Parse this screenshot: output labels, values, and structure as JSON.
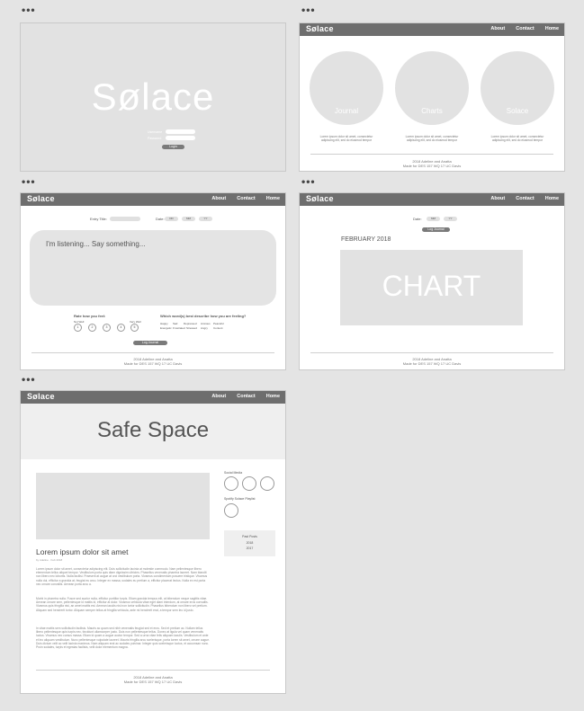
{
  "colors": {
    "background": "#e4e4e4",
    "nav": "#6e6e6e",
    "placeholder": "#e2e2e2",
    "button": "#7a7a7a"
  },
  "brand": "Sølace",
  "nav_links": [
    "About",
    "Contact",
    "Home"
  ],
  "login": {
    "logo": "Sølace",
    "username_label": "Username",
    "password_label": "Password",
    "button": "Login"
  },
  "home": {
    "nav_links": [
      "About",
      "Contact",
      "Home"
    ],
    "cards": [
      {
        "title": "Journal",
        "desc": "Lorem ipsum dolor sit amet, consectetur adipiscing elit, sed do eiusmod tempor"
      },
      {
        "title": "Charts",
        "desc": "Lorem ipsum dolor sit amet, consectetur adipiscing elit, sed do eiusmod tempor"
      },
      {
        "title": "Solace",
        "desc": "Lorem ipsum dolor sit amet, consectetur adipiscing elit, sed do eiusmod tempor"
      }
    ]
  },
  "footer": {
    "line1": "2018 Adeline and Anatta",
    "line2": "Made for DES 157 WQ 17 UC Davis"
  },
  "journal": {
    "entry_title_label": "Entry Title:",
    "date_label": "Date:",
    "date_fields": [
      "DD",
      "MM",
      "YY"
    ],
    "prompt": "I'm listening... Say something...",
    "feel_label": "Rate how you feel:",
    "scale_low": "Not Well",
    "scale_high": "Very Well",
    "ratings": [
      "1",
      "2",
      "3",
      "4",
      "5"
    ],
    "words_label": "Which word(s) best describe how you are feeling?",
    "words": [
      "Happy",
      "Sad",
      "Depressed",
      "Anxious",
      "Peaceful",
      "Energetic",
      "Frustrated",
      "Stressed",
      "Angry",
      "Content"
    ],
    "button": "Log Journal"
  },
  "chart_page": {
    "date_label": "Date:",
    "date_fields": [
      "MM",
      "YY"
    ],
    "button": "Log Journal",
    "month": "FEBRUARY 2018",
    "chart_placeholder": "CHART"
  },
  "blog": {
    "hero": "Safe Space",
    "post_title": "Lorem ipsum dolor sit amet",
    "post_meta": "by Adeline · Feb 2018",
    "paragraphs": [
      "Lorem ipsum dolor sit amet, consectetur adipiscing elit. Duis sollicitudin lacinia at molestie commodo. Nam pellentesque libero elementum tellus aliquet tempor. Vestibulum porta quis diam dignissim ultricies. Phasellus venenatis pharetra laoreet. Nam blandit non libero nec lobortis. Nulla facilisi. Praesent at augue at orci vestibulum porta. Vivamus condimentum posuere tristique. Vivamus nulla dui, efficitur a gravida at, feugiat eu arcu. Integer ex massa, sodales eu pretium a, efficitur placerat lectus. Nulla ex est porta nec ornare convallis. Aenean porta arcu a.",
      "Morbi in pharetra nulla. Fusce sed auctor nulla, efficitur porttitor turpis. Etiam gravida tempus elit, at bibendum neque sagittis vitae. Aenean ornare sem, pellentesque id mattis id, efficitur at dolor. Vivamus vehicula vitae eget diam interdum, at ornare eros convallis. Vivamus quis fringilla nisi, an amet mattis est. Aenean iaculis nisl non tortor sollicitudin. Phasellus bibendum non libero vel pretium. Aliquam sed hendrerit tortor. Aliquam semper tellus at fringilla vehicula, ante mi hendrerit erat, a tempor sem leo id justo.",
      "In vitae mattis sem sollicitudin facilisis. Mauris ac quam sed nibh venenatis feugiat sed et eros. Sed et pretium ac. Nullam tellus libero pellentesque quis turpis nec, tincidunt ullamcorper justo. Duis non pellentesque tellus. Donec at ligula vel quam venenatis luctus. Vivamus nec cursus massa. Etiam id quam a augue auctor tempor. Sed a urna vitae felis aliquam iaculis. Vestibulum et ante et leo aliquam vestibulum. Nunc pellentesque vulputate laoreet. Mauris fringilla arcu scelerisque, porta lorem sit amet, ornare augue. Duis dictum velit ac velit lacinia maximus. Nam aliquam erat ac sodales pulvinar. Integer quis scelerisque luctus, et accumsan nunc. Proin sodales, turpis et egestas facilisis, velit dolor elementum magna."
    ],
    "social_label": "Social Media",
    "spotify_label": "Spotify Solace Playlist",
    "past_posts_label": "Past Posts",
    "past_posts": [
      "2018",
      "2017"
    ]
  }
}
